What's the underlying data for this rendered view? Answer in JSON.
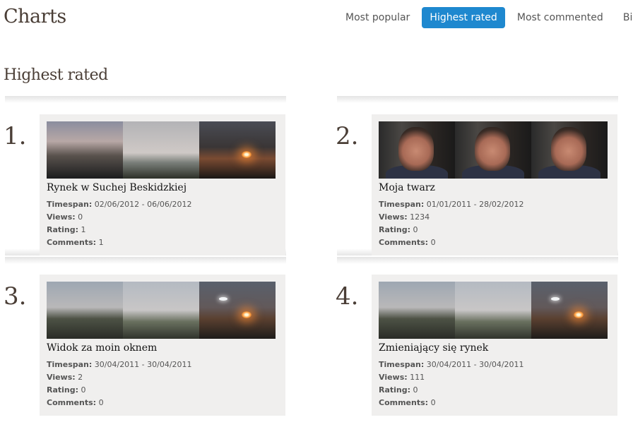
{
  "header": {
    "title": "Charts"
  },
  "nav": {
    "tabs": [
      {
        "label": "Most popular",
        "active": false
      },
      {
        "label": "Highest rated",
        "active": true
      },
      {
        "label": "Most commented",
        "active": false
      },
      {
        "label": "Biggest",
        "active": false
      }
    ]
  },
  "section": {
    "title": "Highest rated"
  },
  "labels": {
    "timespan": "Timespan:",
    "views": "Views:",
    "rating": "Rating:",
    "comments": "Comments:"
  },
  "items": [
    {
      "rank": "1.",
      "title": "Rynek w Suchej Beskidzkiej",
      "timespan": "02/06/2012 - 06/06/2012",
      "views": "0",
      "rating": "1",
      "comments": "1"
    },
    {
      "rank": "2.",
      "title": "Moja twarz",
      "timespan": "01/01/2011 - 28/02/2012",
      "views": "1234",
      "rating": "0",
      "comments": "0"
    },
    {
      "rank": "3.",
      "title": "Widok za moin oknem",
      "timespan": "30/04/2011 - 30/04/2011",
      "views": "2",
      "rating": "0",
      "comments": "0"
    },
    {
      "rank": "4.",
      "title": "Zmieniający się rynek",
      "timespan": "30/04/2011 - 30/04/2011",
      "views": "111",
      "rating": "0",
      "comments": "0"
    }
  ],
  "colors": {
    "accent": "#1e88cf",
    "card_bg": "#f0efee",
    "heading": "#4a3e36"
  }
}
